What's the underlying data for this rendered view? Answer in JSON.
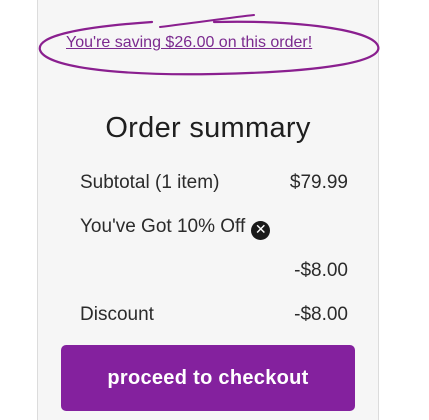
{
  "savings": {
    "text": "You're saving $26.00 on this order!"
  },
  "summary": {
    "title": "Order summary",
    "subtotal_label": "Subtotal (1 item)",
    "subtotal_value": "$79.99",
    "promo_label": "You've Got 10% Off",
    "promo_remove_icon": "✕",
    "promo_amount": "-$8.00",
    "discount_label": "Discount",
    "discount_value": "-$8.00"
  },
  "checkout": {
    "label": "proceed to checkout"
  },
  "colors": {
    "accent": "#84219e",
    "link": "#7b2a8f",
    "annotation": "#8a1f8f"
  },
  "icons": {
    "remove": "close-circle-icon"
  }
}
